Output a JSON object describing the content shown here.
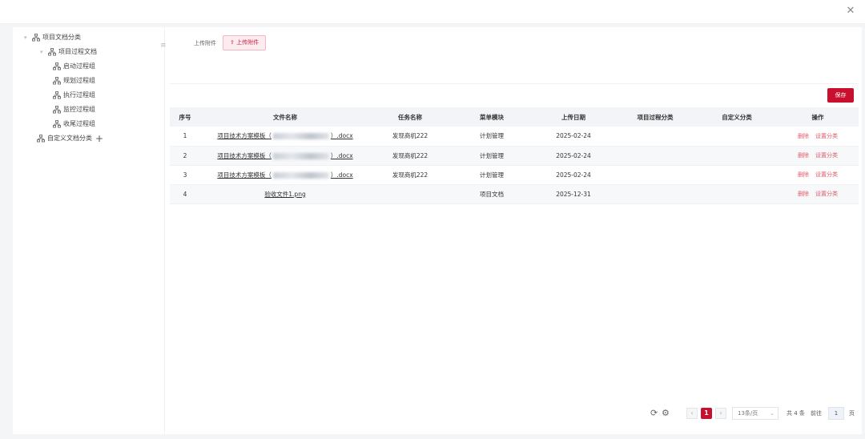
{
  "window": {
    "close_icon": "close-icon"
  },
  "tree": {
    "root": "项目文档分类",
    "process_docs": "项目过程文档",
    "children": [
      "启动过程组",
      "规划过程组",
      "执行过程组",
      "监控过程组",
      "收尾过程组"
    ],
    "custom": "自定义文档分类",
    "add_symbol": "+"
  },
  "upload": {
    "label": "上传附件",
    "button": "⇪ 上传附件"
  },
  "toolbar": {
    "save_label": "保存"
  },
  "table": {
    "headers": [
      "序号",
      "文件名称",
      "任务名称",
      "菜单模块",
      "上传日期",
      "项目过程分类",
      "自定义分类",
      "操作"
    ],
    "rows": [
      {
        "index": "1",
        "file_prefix": "项目技术方案模板（",
        "file_suffix": "）.docx",
        "task": "发现商机222",
        "module": "计划管理",
        "date": "2025-02-24",
        "process_cat": "",
        "custom_cat": ""
      },
      {
        "index": "2",
        "file_prefix": "项目技术方案模板（",
        "file_suffix": "）.docx",
        "task": "发现商机222",
        "module": "计划管理",
        "date": "2025-02-24",
        "process_cat": "",
        "custom_cat": ""
      },
      {
        "index": "3",
        "file_prefix": "项目技术方案模板（",
        "file_suffix": "）.docx",
        "task": "发现商机222",
        "module": "计划管理",
        "date": "2025-02-24",
        "process_cat": "",
        "custom_cat": ""
      },
      {
        "index": "4",
        "file_prefix": "验收文件1.png",
        "file_suffix": "",
        "task": "",
        "module": "项目文档",
        "date": "2025-12-31",
        "process_cat": "",
        "custom_cat": ""
      }
    ],
    "op_delete": "删除",
    "op_classify": "设置分类"
  },
  "pagination": {
    "prev": "‹",
    "current": "1",
    "next": "›",
    "page_size": "13条/页",
    "total": "共 4 条",
    "goto": "前往",
    "goto_value": "1",
    "page_unit": "页"
  },
  "colors": {
    "accent": "#c8102e",
    "link_red": "#e05a6a"
  }
}
